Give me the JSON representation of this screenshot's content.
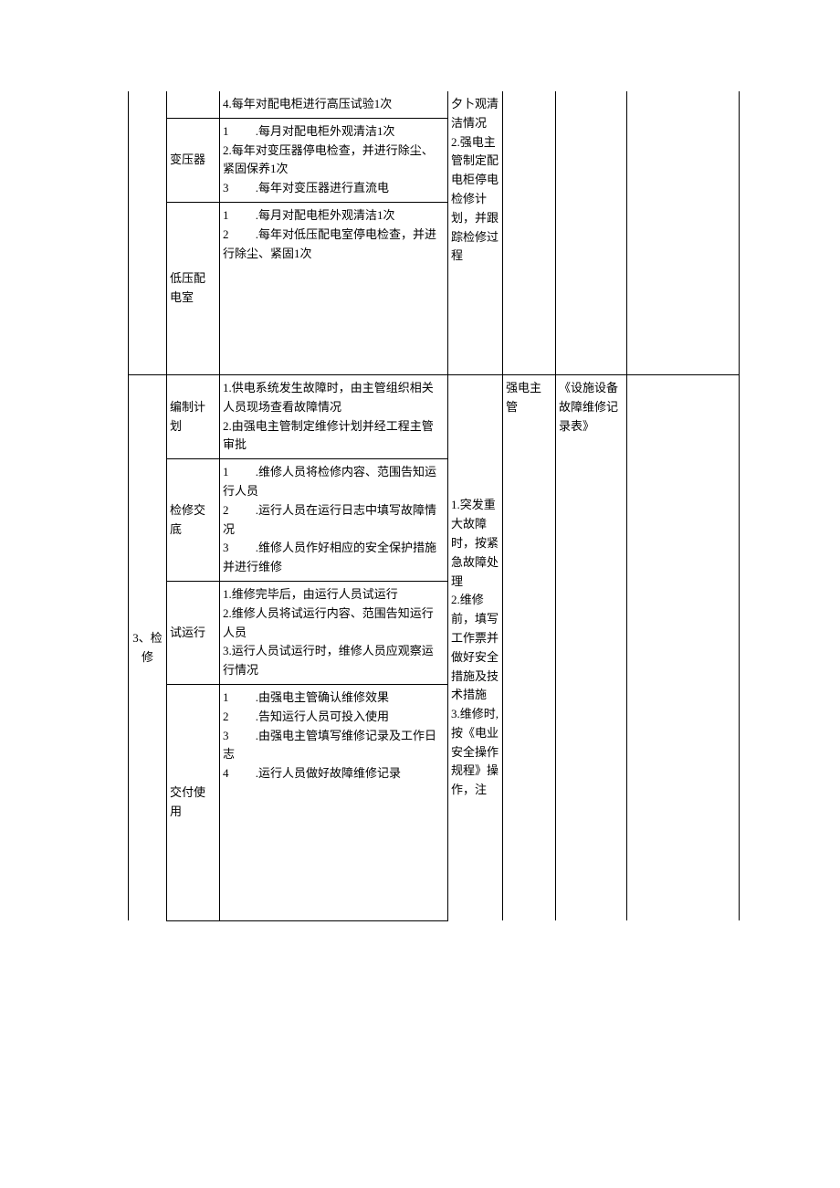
{
  "section1": {
    "row_a": {
      "col2": "4.每年对配电柜进行高压试验1次"
    },
    "row_b": {
      "col1": "变压器",
      "col2": "1         .每月对配电柜外观清洁1次\n2.每年对变压器停电检查，并进行除尘、紧固保养1次\n3         .每年对变压器进行直流电"
    },
    "row_c": {
      "col1": "低压配电室",
      "col2": "1         .每月对配电柜外观清洁1次\n2         .每年对低压配电室停电检查，并进行除尘、紧固1次"
    },
    "col3": "夕卜观清洁情况\n2.强电主管制定配电柜停电检修计划，并跟踪检修过程"
  },
  "section2": {
    "col0": "3、检修",
    "rows": {
      "a": {
        "col1": "编制计划",
        "col2": "1.供电系统发生故障时，由主管组织相关人员现场查看故障情况\n2.由强电主管制定维修计划并经工程主管审批"
      },
      "b": {
        "col1": "检修交底",
        "col2": "1         .维修人员将检修内容、范围告知运行人员\n2         .运行人员在运行日志中填写故障情况\n3         .维修人员作好相应的安全保护措施并进行维修"
      },
      "c": {
        "col1": "试运行",
        "col2": "1.维修完毕后，由运行人员试运行\n2.维修人员将试运行内容、范围告知运行人员\n3.运行人员试运行时，维修人员应观察运行情况"
      },
      "d": {
        "col1": "交付使用",
        "col2": "1         .由强电主管确认维修效果\n2         .告知运行人员可投入使用\n3         .由强电主管填写维修记录及工作日志\n4         .运行人员做好故障维修记录"
      }
    },
    "col3": "1.突发重大故障时，按紧急故障处理\n2.维修前，填写工作票并做好安全措施及技术措施\n3.维修时,按《电业安全操作规程》操作，注",
    "col4": "强电主管",
    "col5": "《设施设备故障维修记录表》"
  }
}
